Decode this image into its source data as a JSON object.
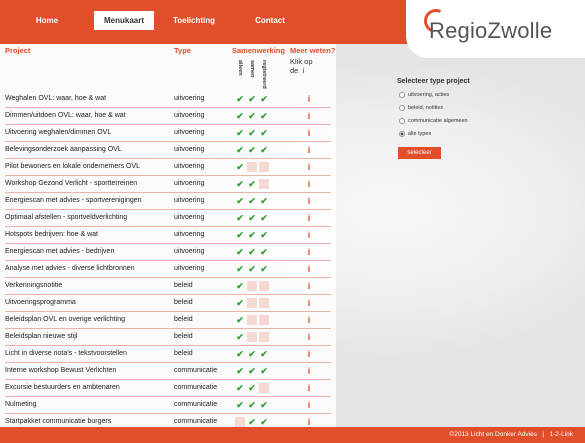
{
  "nav": {
    "items": [
      {
        "label": "Home",
        "active": false
      },
      {
        "label": "Menukaart",
        "active": true
      },
      {
        "label": "Toelichting",
        "active": false
      },
      {
        "label": "Contact",
        "active": false
      }
    ]
  },
  "logo": {
    "text": "RegioZwolle"
  },
  "table": {
    "headers": {
      "project": "Project",
      "type": "Type",
      "samenwerking": "Samenwerking",
      "meer": "Meer weten?"
    },
    "subheaders": [
      "alleen",
      "samen",
      "registreerd"
    ],
    "klik": {
      "line1": "Klik op",
      "line2": "de",
      "icon": "i"
    },
    "rows": [
      {
        "name": "Weghalen OVL: waar, hoe & wat",
        "type": "uitvoering",
        "checks": [
          true,
          true,
          true
        ]
      },
      {
        "name": "Dimmen/uitdoen OVL: waar, hoe & wat",
        "type": "uitvoering",
        "checks": [
          true,
          true,
          true
        ]
      },
      {
        "name": "Uitvoering weghalen/dimmen OVL",
        "type": "uitvoering",
        "checks": [
          true,
          true,
          true
        ]
      },
      {
        "name": "Belevingsonderzoek aanpassing OVL",
        "type": "uitvoering",
        "checks": [
          true,
          true,
          true
        ]
      },
      {
        "name": "Pilot bewoners en lokale ondernemers OVL",
        "type": "uitvoering",
        "checks": [
          true,
          false,
          false
        ]
      },
      {
        "name": "Workshop Gezond Verlicht - sportterreinen",
        "type": "uitvoering",
        "checks": [
          true,
          true,
          false
        ]
      },
      {
        "name": "Energiescan met advies - sportverenigingen",
        "type": "uitvoering",
        "checks": [
          true,
          true,
          true
        ]
      },
      {
        "name": "Optimaal afstellen - sportveldverlichting",
        "type": "uitvoering",
        "checks": [
          true,
          true,
          true
        ]
      },
      {
        "name": "Hotspots bedrijven: hoe & wat",
        "type": "uitvoering",
        "checks": [
          true,
          true,
          true
        ]
      },
      {
        "name": "Energiescan met advies - bedrijven",
        "type": "uitvoering",
        "checks": [
          true,
          true,
          true
        ]
      },
      {
        "name": "Analyse met advies - diverse lichtbronnen",
        "type": "uitvoering",
        "checks": [
          true,
          true,
          true
        ]
      },
      {
        "name": "Verkenningsnotitie",
        "type": "beleid",
        "checks": [
          true,
          false,
          false
        ]
      },
      {
        "name": "Uitvoeringsprogramma",
        "type": "beleid",
        "checks": [
          true,
          false,
          false
        ]
      },
      {
        "name": "Beleidsplan OVL en overige verlichting",
        "type": "beleid",
        "checks": [
          true,
          false,
          false
        ]
      },
      {
        "name": "Beleidsplan nieuwe stijl",
        "type": "beleid",
        "checks": [
          true,
          false,
          false
        ]
      },
      {
        "name": "Licht in diverse nota's - tekstvoorstellen",
        "type": "beleid",
        "checks": [
          true,
          true,
          true
        ]
      },
      {
        "name": "Interne workshop Bewust Verlichten",
        "type": "communicatie",
        "checks": [
          true,
          true,
          true
        ]
      },
      {
        "name": "Excursie bestuurders en ambtenaren",
        "type": "communicatie",
        "checks": [
          true,
          true,
          false
        ]
      },
      {
        "name": "Nulmeting",
        "type": "communicatie",
        "checks": [
          true,
          true,
          true
        ]
      },
      {
        "name": "Startpakket communicatie burgers",
        "type": "communicatie",
        "checks": [
          false,
          true,
          true
        ]
      }
    ],
    "check_glyph": "✔",
    "info_glyph": "i"
  },
  "filter": {
    "title": "Selecteer type project",
    "options": [
      {
        "label": "uitvoering, acties",
        "selected": false
      },
      {
        "label": "beleid, notities",
        "selected": false
      },
      {
        "label": "communicatie algemeen",
        "selected": false
      },
      {
        "label": "alle types",
        "selected": true
      }
    ],
    "button": "selecteer"
  },
  "footer": {
    "copyright": "©2013 Licht en Donker Advies",
    "separator": "|",
    "link": "1-2-Link"
  },
  "colors": {
    "accent": "#e04e2c",
    "check": "#3a9d3a"
  },
  "icons": {
    "check": "check-icon",
    "info": "info-icon",
    "radio": "radio-icon"
  }
}
